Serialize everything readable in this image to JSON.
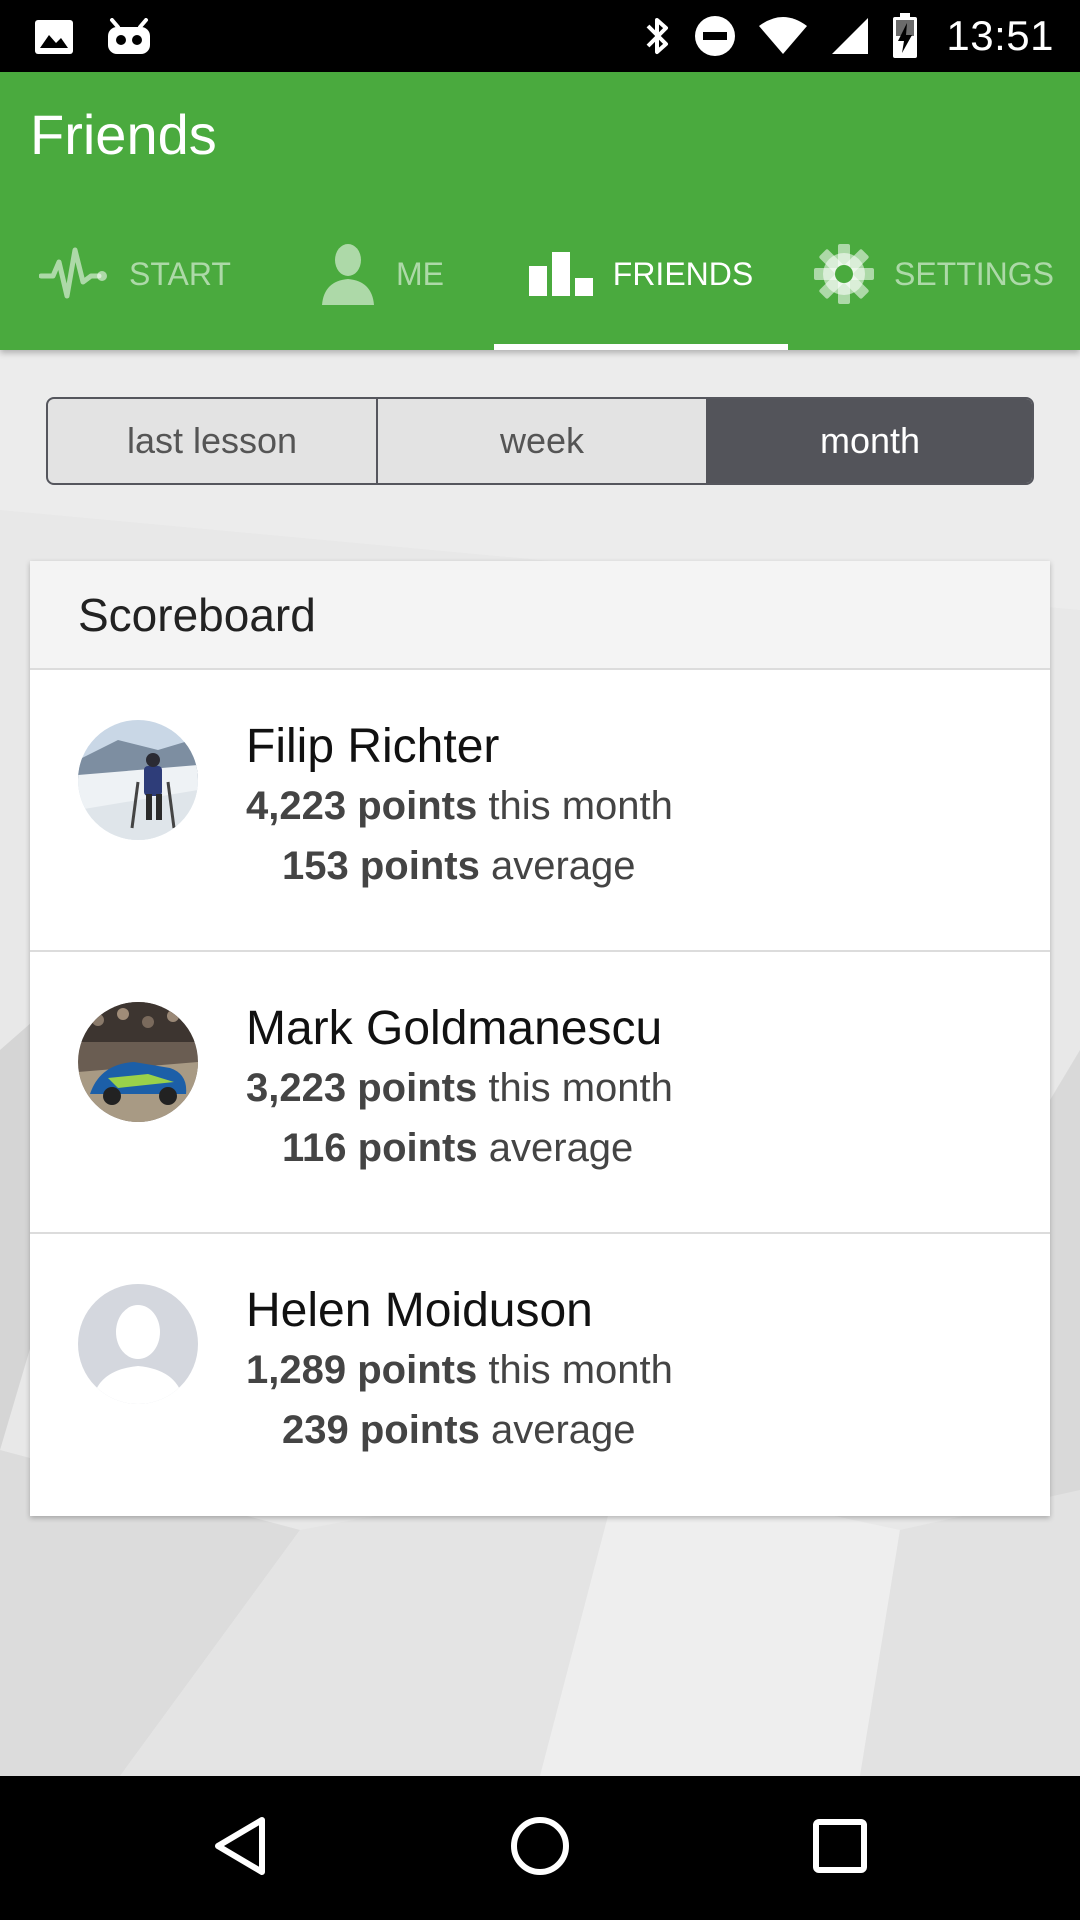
{
  "status_bar": {
    "time": "13:51",
    "icons": [
      "image-icon",
      "cyanogen-icon",
      "bluetooth-icon",
      "do-not-disturb-icon",
      "wifi-icon",
      "signal-icon",
      "battery-charging-icon"
    ]
  },
  "app_bar": {
    "title": "Friends",
    "tabs": [
      {
        "label": "START",
        "icon": "pulse-icon",
        "active": false
      },
      {
        "label": "ME",
        "icon": "person-icon",
        "active": false
      },
      {
        "label": "FRIENDS",
        "icon": "bar-chart-icon",
        "active": true
      },
      {
        "label": "SETTINGS",
        "icon": "gear-icon",
        "active": false
      }
    ],
    "colors": {
      "primary": "#4aaa3e"
    }
  },
  "period_selector": {
    "options": [
      "last lesson",
      "week",
      "month"
    ],
    "selected": "month"
  },
  "scoreboard": {
    "title": "Scoreboard",
    "entries": [
      {
        "name": "Filip Richter",
        "points": "4,223 points",
        "points_suffix": "this month",
        "average": "153 points",
        "average_suffix": "average",
        "avatar": "photo-avatar-skier"
      },
      {
        "name": "Mark Goldmanescu",
        "points": "3,223 points",
        "points_suffix": "this month",
        "average": "116 points",
        "average_suffix": "average",
        "avatar": "photo-avatar-rally-car"
      },
      {
        "name": "Helen Moiduson",
        "points": "1,289 points",
        "points_suffix": "this month",
        "average": "239 points",
        "average_suffix": "average",
        "avatar": "default-avatar"
      }
    ]
  },
  "nav_bar": {
    "buttons": [
      "back-icon",
      "home-icon",
      "recents-icon"
    ]
  }
}
